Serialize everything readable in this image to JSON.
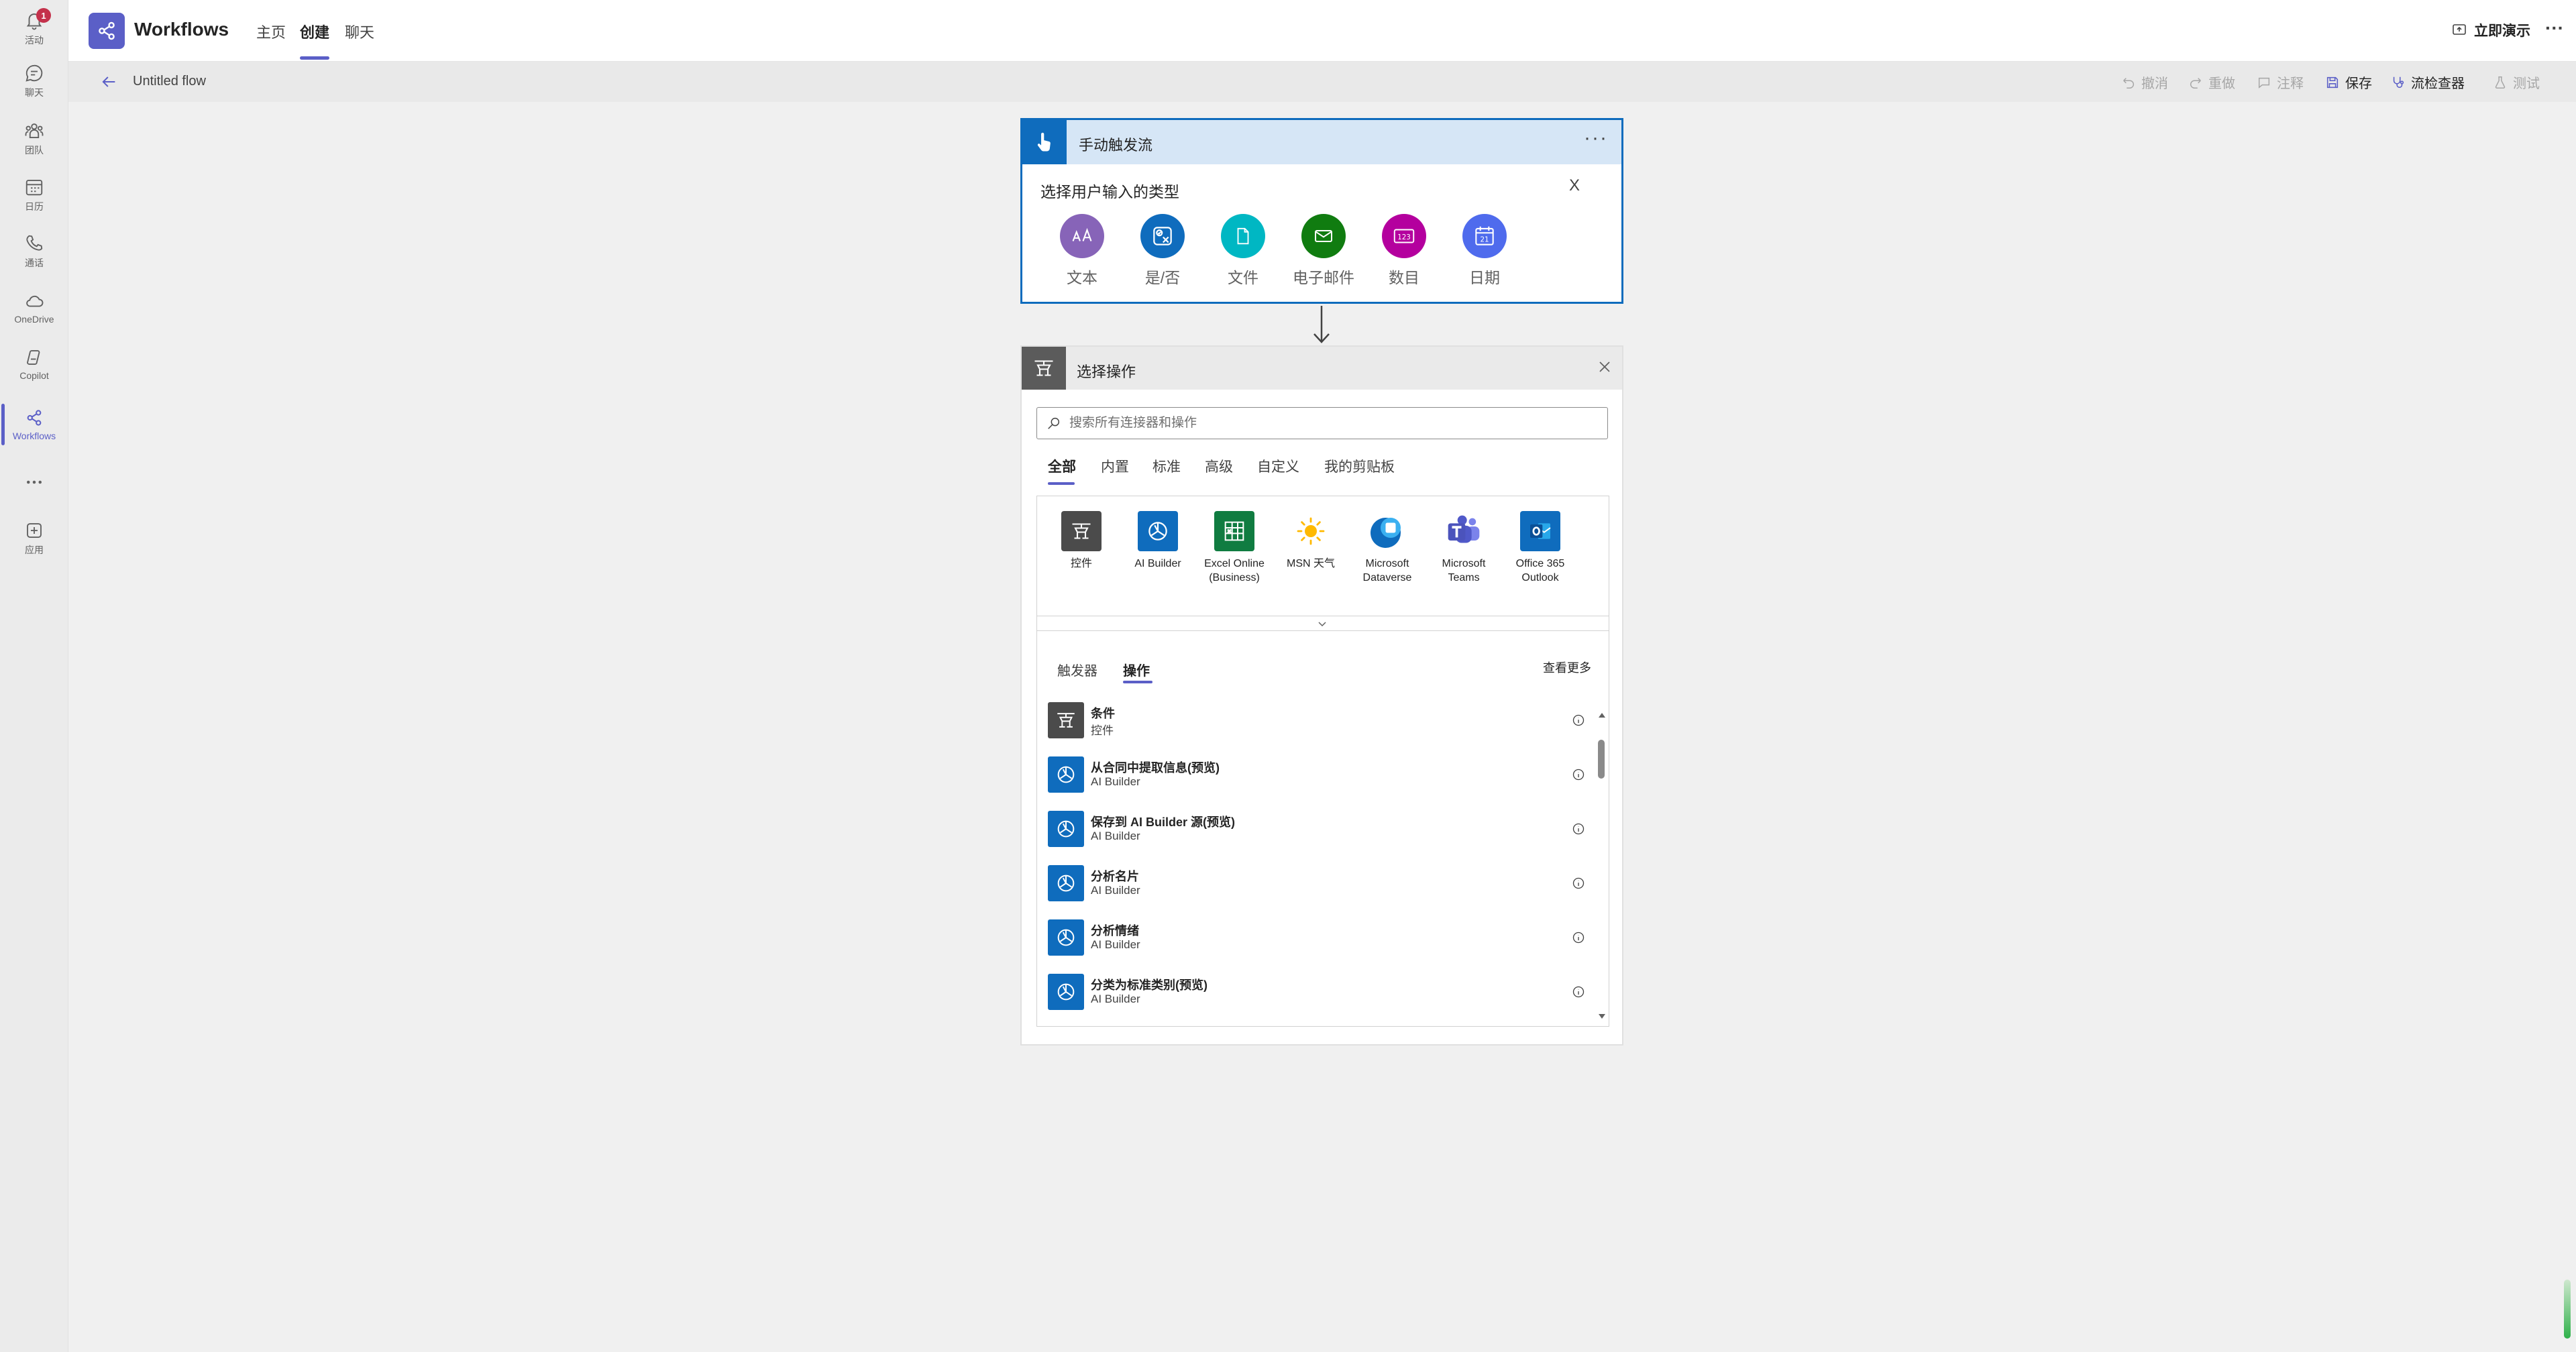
{
  "rail": {
    "items": [
      {
        "label": "活动",
        "icon": "bell-icon",
        "badge": "1"
      },
      {
        "label": "聊天",
        "icon": "chat-icon"
      },
      {
        "label": "团队",
        "icon": "teams-icon"
      },
      {
        "label": "日历",
        "icon": "calendar-icon"
      },
      {
        "label": "通话",
        "icon": "phone-icon"
      },
      {
        "label": "OneDrive",
        "icon": "cloud-icon"
      },
      {
        "label": "Copilot",
        "icon": "copilot-icon"
      },
      {
        "label": "Workflows",
        "icon": "workflows-icon",
        "active": true
      },
      {
        "label": "",
        "icon": "more-icon"
      },
      {
        "label": "应用",
        "icon": "add-apps-icon"
      }
    ]
  },
  "header": {
    "app_title": "Workflows",
    "tabs": [
      {
        "label": "主页"
      },
      {
        "label": "创建",
        "active": true
      },
      {
        "label": "聊天"
      }
    ],
    "present_label": "立即演示",
    "more": "···"
  },
  "command_bar": {
    "flow_name": "Untitled flow",
    "undo": "撤消",
    "redo": "重做",
    "comment": "注释",
    "save": "保存",
    "flow_checker": "流检查器",
    "test": "测试"
  },
  "trigger": {
    "title": "手动触发流",
    "more": "···",
    "prompt": "选择用户输入的类型",
    "close": "X",
    "input_types": [
      {
        "label": "文本",
        "icon": "text-icon",
        "color": "#8764b8"
      },
      {
        "label": "是/否",
        "icon": "yes-no-icon",
        "color": "#0f6cbd"
      },
      {
        "label": "文件",
        "icon": "file-icon",
        "color": "#00b7c3"
      },
      {
        "label": "电子邮件",
        "icon": "email-icon",
        "color": "#107c10"
      },
      {
        "label": "数目",
        "icon": "number-icon",
        "color": "#b4009e"
      },
      {
        "label": "日期",
        "icon": "date-icon",
        "color": "#4f6bed"
      }
    ]
  },
  "action": {
    "title": "选择操作",
    "search_placeholder": "搜索所有连接器和操作",
    "filters": [
      {
        "label": "全部",
        "active": true
      },
      {
        "label": "内置"
      },
      {
        "label": "标准"
      },
      {
        "label": "高级"
      },
      {
        "label": "自定义"
      },
      {
        "label": "我的剪贴板"
      }
    ],
    "connectors": [
      {
        "label": "控件",
        "icon": "control-icon",
        "color": "#4b4b4b"
      },
      {
        "label": "AI Builder",
        "icon": "ai-builder-icon",
        "color": "#0f6cbd"
      },
      {
        "label": "Excel Online\n(Business)",
        "icon": "excel-icon",
        "color": "#107c41"
      },
      {
        "label": "MSN 天气",
        "icon": "sun-icon",
        "color": "#ffffff"
      },
      {
        "label": "Microsoft\nDataverse",
        "icon": "dataverse-icon",
        "color": "#0f6cbd"
      },
      {
        "label": "Microsoft\nTeams",
        "icon": "teams-icon",
        "color": "#ffffff"
      },
      {
        "label": "Office 365\nOutlook",
        "icon": "outlook-icon",
        "color": "#0f6cbd"
      }
    ],
    "sub_tabs": [
      {
        "label": "触发器"
      },
      {
        "label": "操作",
        "active": true
      }
    ],
    "see_more": "查看更多",
    "actions": [
      {
        "name": "条件",
        "connector": "控件",
        "icon": "control-icon",
        "color": "#4b4b4b"
      },
      {
        "name": "从合同中提取信息(预览)",
        "connector": "AI Builder",
        "icon": "ai-builder-icon",
        "color": "#0f6cbd"
      },
      {
        "name": "保存到 AI Builder 源(预览)",
        "connector": "AI Builder",
        "icon": "ai-builder-icon",
        "color": "#0f6cbd"
      },
      {
        "name": "分析名片",
        "connector": "AI Builder",
        "icon": "ai-builder-icon",
        "color": "#0f6cbd"
      },
      {
        "name": "分析情绪",
        "connector": "AI Builder",
        "icon": "ai-builder-icon",
        "color": "#0f6cbd"
      },
      {
        "name": "分类为标准类别(预览)",
        "connector": "AI Builder",
        "icon": "ai-builder-icon",
        "color": "#0f6cbd"
      }
    ]
  },
  "colors": {
    "accent": "#5b5fc7",
    "trigger_blue": "#0f6cbd",
    "badge_red": "#c4314b"
  }
}
